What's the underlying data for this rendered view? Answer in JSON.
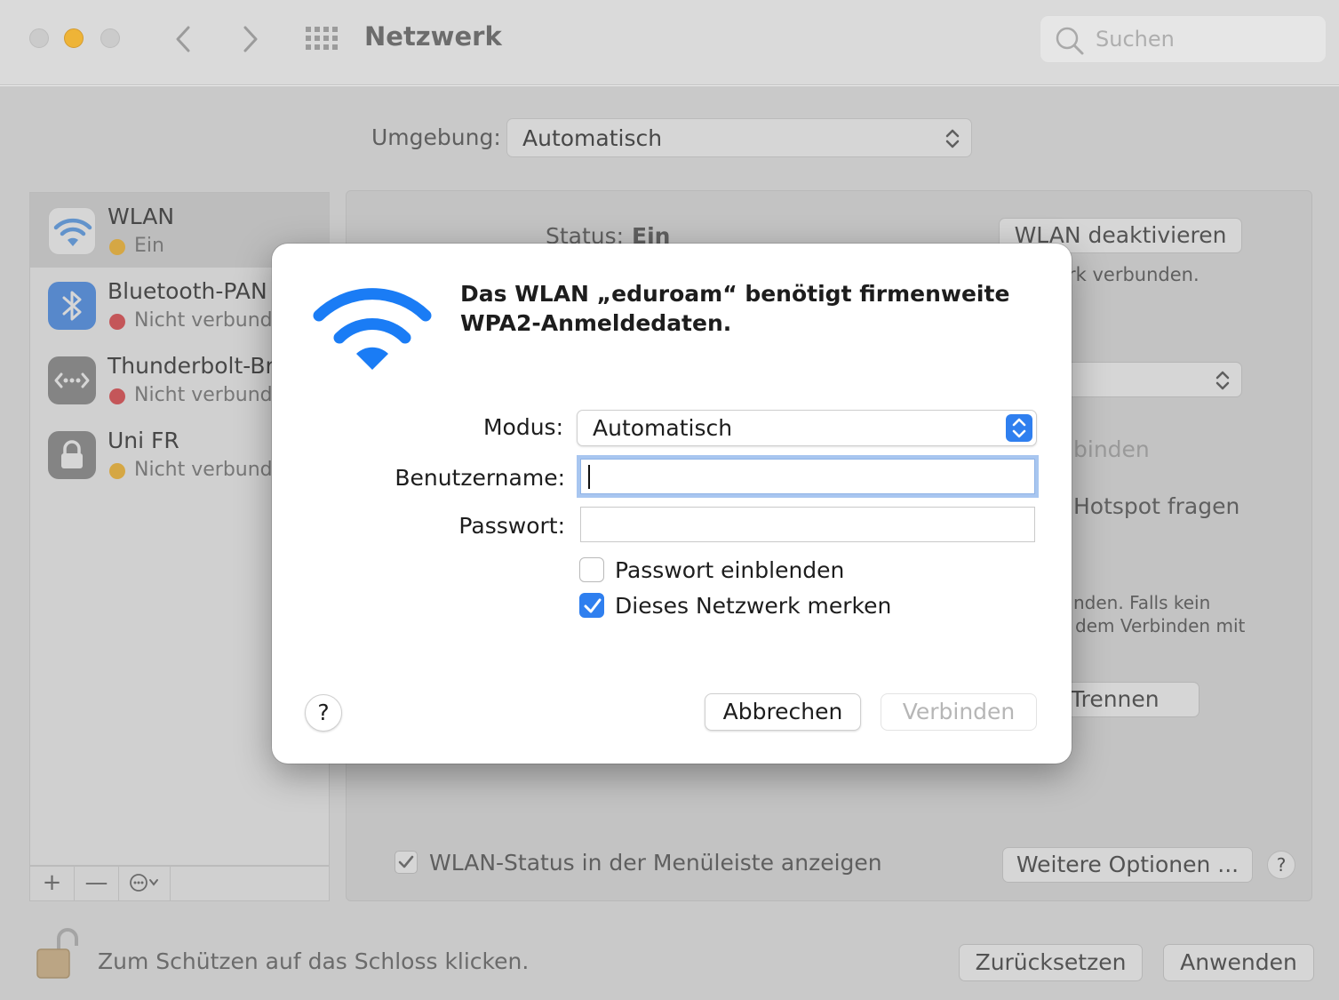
{
  "window": {
    "title": "Netzwerk",
    "search_placeholder": "Suchen"
  },
  "environment": {
    "label": "Umgebung:",
    "value": "Automatisch"
  },
  "sidebar": {
    "items": [
      {
        "name": "WLAN",
        "status": "Ein",
        "status_color": "#febc2e",
        "icon": "wifi-icon"
      },
      {
        "name": "Bluetooth-PAN",
        "status": "Nicht verbunden",
        "status_color": "#e5484d",
        "icon": "bluetooth-icon"
      },
      {
        "name": "Thunderbolt-Bridge",
        "status": "Nicht verbunden",
        "status_color": "#e5484d",
        "icon": "thunderbolt-icon"
      },
      {
        "name": "Uni FR",
        "status": "Nicht verbunden",
        "status_color": "#febc2e",
        "icon": "lock-icon"
      }
    ],
    "toolbar": {
      "add": "+",
      "remove": "—"
    }
  },
  "main": {
    "status_label": "Status:",
    "status_value": "Ein",
    "wifi_toggle": "WLAN deaktivieren",
    "connected_text": "rk verbunden.",
    "join_text": "binden",
    "hotspot_text": "Hotspot fragen",
    "info_line1": "nden. Falls kein",
    "info_line2": "dem Verbinden mit",
    "disconnect": "Trennen",
    "menubar_checkbox": "WLAN-Status in der Menüleiste anzeigen",
    "more_options": "Weitere Optionen ...",
    "help": "?"
  },
  "footer": {
    "lock_text": "Zum Schützen auf das Schloss klicken.",
    "reset": "Zurücksetzen",
    "apply": "Anwenden"
  },
  "dialog": {
    "title": "Das WLAN „eduroam“ benötigt firmenweite WPA2-Anmeldedaten.",
    "mode_label": "Modus:",
    "mode_value": "Automatisch",
    "username_label": "Benutzername:",
    "username_value": "",
    "password_label": "Passwort:",
    "password_value": "",
    "show_password": {
      "label": "Passwort einblenden",
      "checked": false
    },
    "remember_network": {
      "label": "Dieses Netzwerk merken",
      "checked": true
    },
    "help": "?",
    "cancel": "Abbrechen",
    "connect": "Verbinden"
  },
  "colors": {
    "accent": "#2f7fef",
    "wifi_icon": "#1a7cf5"
  }
}
